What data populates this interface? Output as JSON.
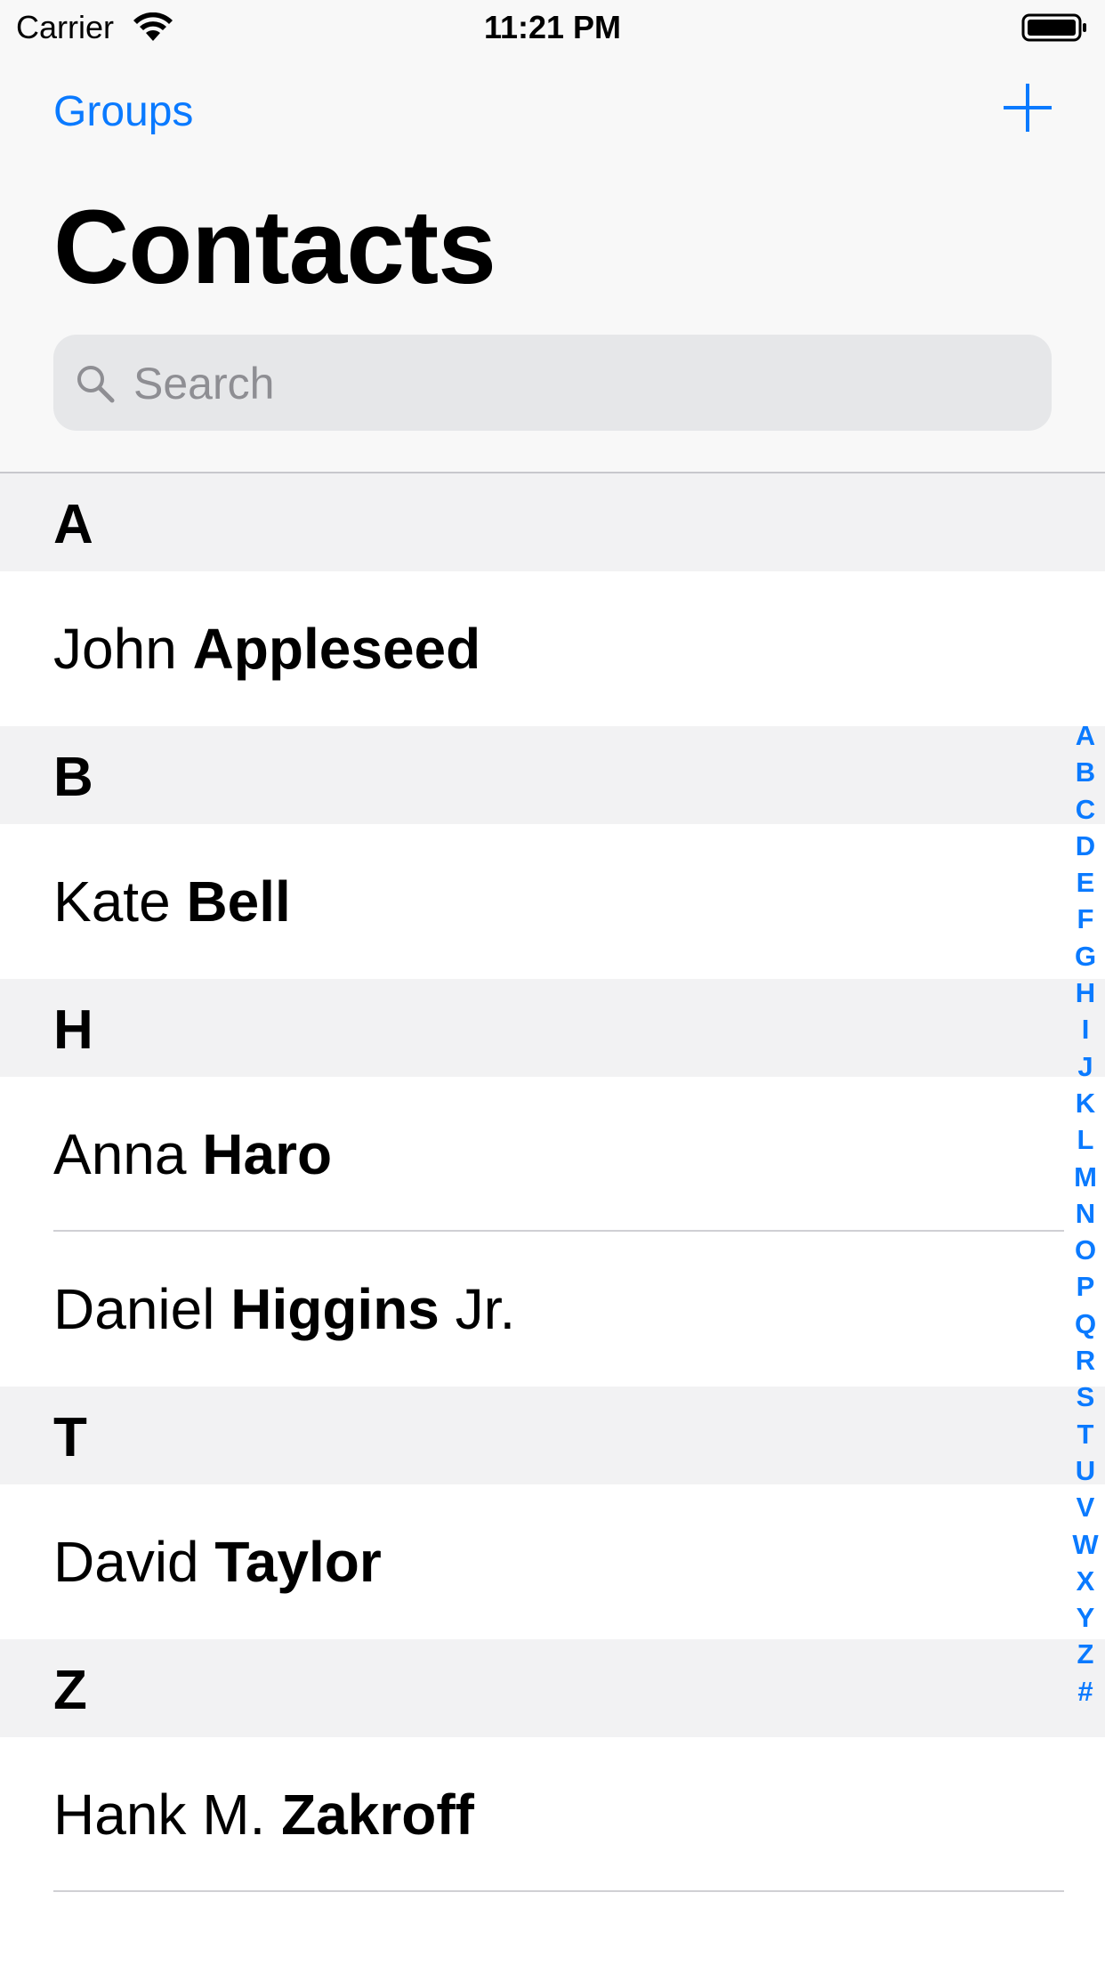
{
  "status_bar": {
    "carrier": "Carrier",
    "time": "11:21 PM",
    "wifi_icon": "wifi-icon",
    "battery_icon": "battery-full-icon"
  },
  "nav": {
    "left_button": "Groups",
    "right_icon": "plus-icon",
    "title": "Contacts"
  },
  "search": {
    "placeholder": "Search",
    "value": "",
    "icon": "search-icon"
  },
  "sections": [
    {
      "letter": "A",
      "contacts": [
        {
          "first": "John",
          "last": "Appleseed",
          "suffix": ""
        }
      ]
    },
    {
      "letter": "B",
      "contacts": [
        {
          "first": "Kate",
          "last": "Bell",
          "suffix": ""
        }
      ]
    },
    {
      "letter": "H",
      "contacts": [
        {
          "first": "Anna",
          "last": "Haro",
          "suffix": ""
        },
        {
          "first": "Daniel",
          "last": "Higgins",
          "suffix": "Jr."
        }
      ]
    },
    {
      "letter": "T",
      "contacts": [
        {
          "first": "David",
          "last": "Taylor",
          "suffix": ""
        }
      ]
    },
    {
      "letter": "Z",
      "contacts": [
        {
          "first": "Hank M.",
          "last": "Zakroff",
          "suffix": ""
        }
      ]
    }
  ],
  "index_letters": [
    "A",
    "B",
    "C",
    "D",
    "E",
    "F",
    "G",
    "H",
    "I",
    "J",
    "K",
    "L",
    "M",
    "N",
    "O",
    "P",
    "Q",
    "R",
    "S",
    "T",
    "U",
    "V",
    "W",
    "X",
    "Y",
    "Z",
    "#"
  ],
  "colors": {
    "accent": "#0a7aff",
    "nav_background": "#f8f8f8",
    "section_header_background": "#f2f2f3",
    "search_background": "#e6e7e9"
  }
}
